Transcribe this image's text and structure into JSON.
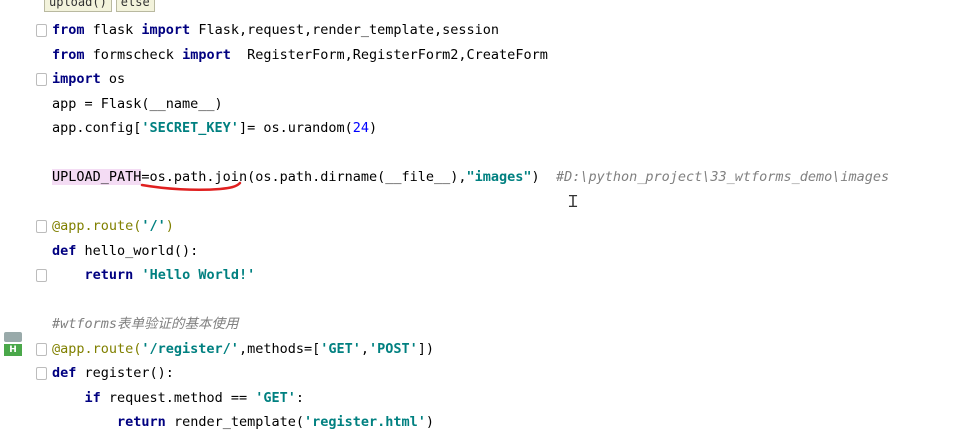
{
  "breadcrumb": [
    "upload()",
    "else"
  ],
  "colors": {
    "keyword": "#000080",
    "string": "#008080",
    "number": "#0000ff",
    "comment": "#808080",
    "decorator": "#808000",
    "annotation_underline": "#e02020"
  },
  "code": {
    "l1": {
      "kw1": "from",
      "mod": " flask ",
      "kw2": "import",
      "rest": " Flask,request,render_template,session"
    },
    "l2": {
      "kw1": "from",
      "mod": " formscheck ",
      "kw2": "import",
      "rest": "  RegisterForm,RegisterForm2,CreateForm"
    },
    "l3": {
      "kw1": "import",
      "rest": " os"
    },
    "l4": {
      "text": "app = Flask(__name__)"
    },
    "l5": {
      "pre": "app.config[",
      "str": "'SECRET_KEY'",
      "mid": "]= os.urandom(",
      "num": "24",
      "post": ")"
    },
    "l7": {
      "var": "UPLOAD_PATH",
      "pre": "=os.path.join(os.path.dirname(__file__),",
      "str": "\"images\"",
      "post": ")  ",
      "comment": "#D:\\python_project\\33_wtforms_demo\\images"
    },
    "l9": {
      "dec": "@app.route(",
      "str": "'/'",
      "post": ")"
    },
    "l10": {
      "kw": "def",
      "rest": " hello_world():"
    },
    "l11": {
      "indent": "    ",
      "kw": "return",
      "sp": " ",
      "str": "'Hello World!'"
    },
    "l13": {
      "comment": "#wtforms表单验证的基本使用"
    },
    "l14": {
      "dec": "@app.route(",
      "str1": "'/register/'",
      "mid": ",methods=[",
      "str2": "'GET'",
      "comma": ",",
      "str3": "'POST'",
      "post": "])"
    },
    "l15": {
      "kw": "def",
      "rest": " register():"
    },
    "l16": {
      "indent": "    ",
      "kw": "if",
      "rest": " request.method == ",
      "str": "'GET'",
      "post": ":"
    },
    "l17": {
      "indent": "        ",
      "kw": "return",
      "rest": " render_template(",
      "str": "'register.html'",
      "post": ")"
    }
  },
  "side_icon_label": "H"
}
